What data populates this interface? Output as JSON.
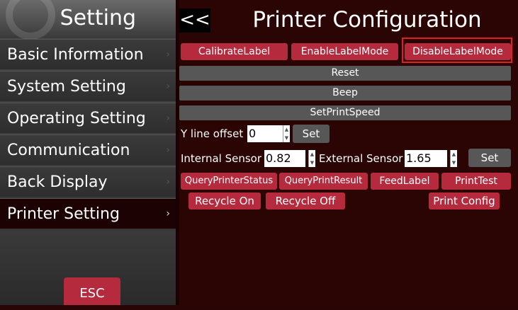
{
  "sidebar": {
    "title": "Setting",
    "items": [
      {
        "label": "Basic Information",
        "chevron": "›"
      },
      {
        "label": "System Setting",
        "chevron": "›"
      },
      {
        "label": "Operating Setting",
        "chevron": "›"
      },
      {
        "label": "Communication",
        "chevron": "›"
      },
      {
        "label": "Back Display",
        "chevron": "›"
      },
      {
        "label": "Printer Setting",
        "chevron": "›"
      }
    ],
    "esc_label": "ESC"
  },
  "header": {
    "back_label": "<<",
    "title": "Printer Configuration"
  },
  "label_mode_buttons": [
    "CalibrateLabel",
    "EnableLabelMode",
    "DisableLabelMode"
  ],
  "actions": {
    "reset": "Reset",
    "beep": "Beep",
    "set_print_speed": "SetPrintSpeed"
  },
  "y_offset": {
    "label": "Y line offset",
    "value": "0",
    "set_label": "Set"
  },
  "sensors": {
    "internal_label": "Internal Sensor",
    "internal_value": "0.82",
    "external_label": "External Sensor",
    "external_value": "1.65",
    "set_label": "Set"
  },
  "query_buttons": [
    "QueryPrinterStatus",
    "QueryPrintResult",
    "FeedLabel",
    "PrintTest"
  ],
  "recycle_buttons": [
    "Recycle On",
    "Recycle Off",
    "Print Config"
  ],
  "colors": {
    "accent": "#b52a3c",
    "background": "#2b0404",
    "highlight_border": "#e02020",
    "gray_button": "#575757"
  }
}
